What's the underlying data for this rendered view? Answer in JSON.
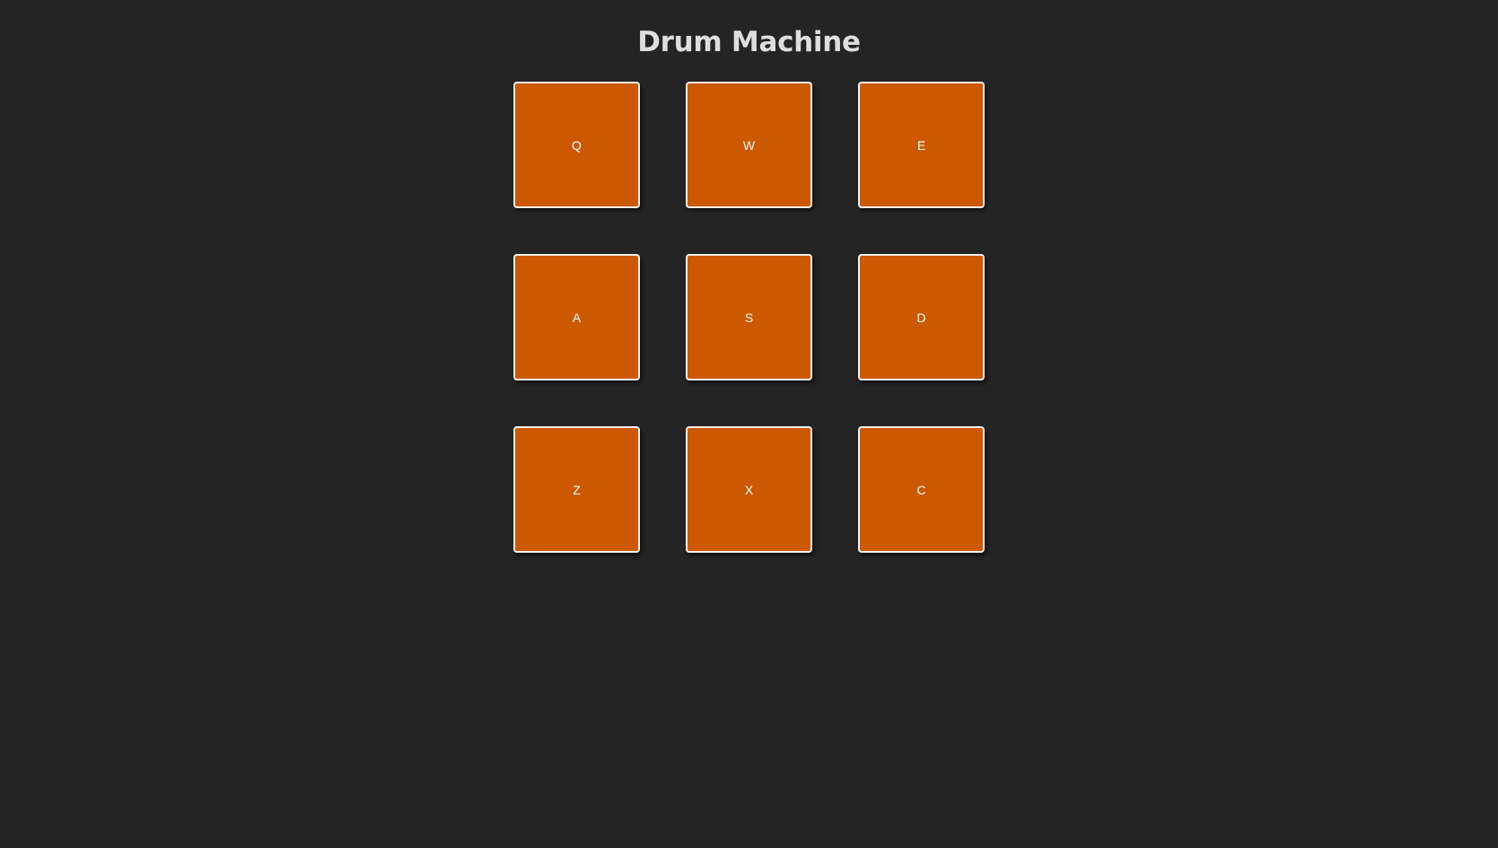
{
  "app": {
    "title": "Drum Machine"
  },
  "theme": {
    "background": "#242424",
    "pad_color": "#cc5800",
    "pad_border": "#f2f2f2",
    "title_color": "#dedede"
  },
  "pads": [
    {
      "key": "Q"
    },
    {
      "key": "W"
    },
    {
      "key": "E"
    },
    {
      "key": "A"
    },
    {
      "key": "S"
    },
    {
      "key": "D"
    },
    {
      "key": "Z"
    },
    {
      "key": "X"
    },
    {
      "key": "C"
    }
  ]
}
